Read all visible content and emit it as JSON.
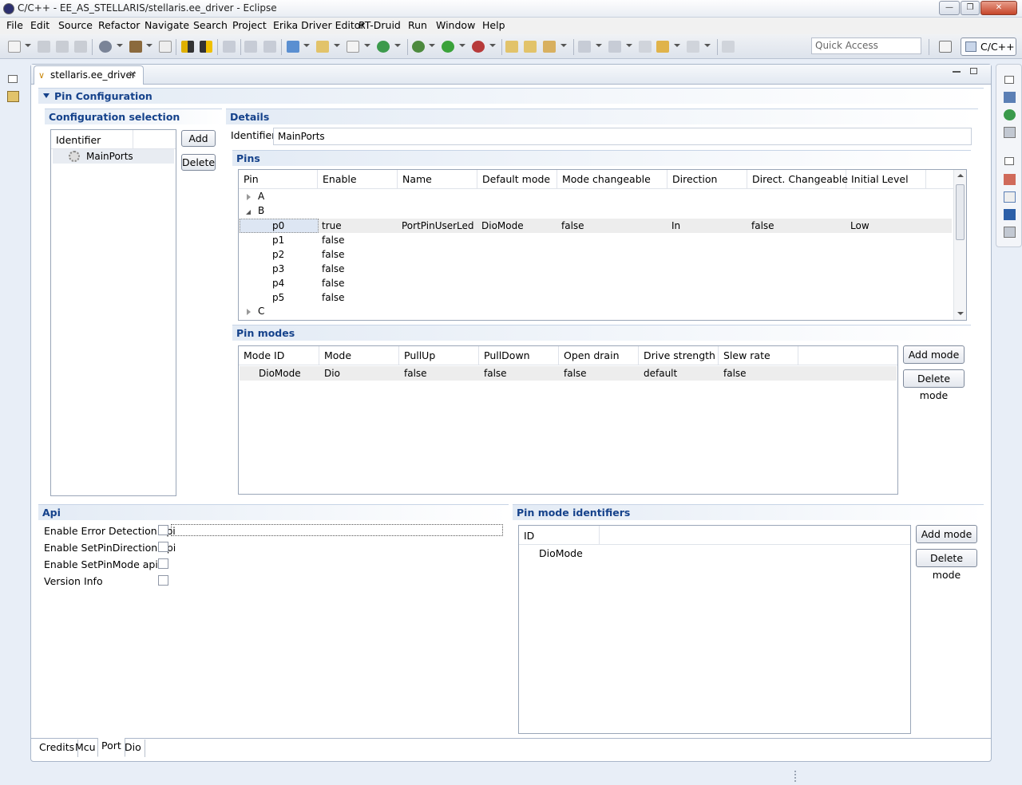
{
  "window": {
    "title": "C/C++ - EE_AS_STELLARIS/stellaris.ee_driver - Eclipse"
  },
  "menu": [
    "File",
    "Edit",
    "Source",
    "Refactor",
    "Navigate",
    "Search",
    "Project",
    "Erika Driver Editor",
    "RT-Druid",
    "Run",
    "Window",
    "Help"
  ],
  "toolbar": {
    "quick_access_placeholder": "Quick Access",
    "perspective": "C/C++"
  },
  "editor_tab": {
    "label": "stellaris.ee_driver"
  },
  "section_title": "Pin Configuration",
  "config_selection": {
    "title": "Configuration selection",
    "header": "Identifier",
    "items": [
      "MainPorts"
    ],
    "add_label": "Add",
    "delete_label": "Delete"
  },
  "details": {
    "title": "Details",
    "identifier_label": "Identifier",
    "identifier_value": "MainPorts"
  },
  "pins": {
    "title": "Pins",
    "columns": [
      "Pin",
      "Enable",
      "Name",
      "Default mode",
      "Mode changeable",
      "Direction",
      "Direct. Changeable",
      "Initial Level"
    ],
    "groups": [
      {
        "label": "A",
        "expanded": false
      },
      {
        "label": "B",
        "expanded": true
      },
      {
        "label": "C",
        "expanded": false
      }
    ],
    "rows": [
      {
        "pin": "p0",
        "enable": "true",
        "name": "PortPinUserLed",
        "default_mode": "DioMode",
        "mode_changeable": "false",
        "direction": "In",
        "direct_changeable": "false",
        "initial_level": "Low"
      },
      {
        "pin": "p1",
        "enable": "false"
      },
      {
        "pin": "p2",
        "enable": "false"
      },
      {
        "pin": "p3",
        "enable": "false"
      },
      {
        "pin": "p4",
        "enable": "false"
      },
      {
        "pin": "p5",
        "enable": "false"
      }
    ]
  },
  "pin_modes": {
    "title": "Pin modes",
    "columns": [
      "Mode ID",
      "Mode",
      "PullUp",
      "PullDown",
      "Open drain",
      "Drive strength",
      "Slew rate"
    ],
    "rows": [
      {
        "mode_id": "DioMode",
        "mode": "Dio",
        "pullup": "false",
        "pulldown": "false",
        "open_drain": "false",
        "drive_strength": "default",
        "slew_rate": "false"
      }
    ],
    "add_label": "Add mode",
    "delete_label": "Delete mode"
  },
  "api": {
    "title": "Api",
    "options": [
      {
        "label": "Enable Error Detection api",
        "checked": false
      },
      {
        "label": "Enable SetPinDirection api",
        "checked": false
      },
      {
        "label": "Enable SetPinMode api",
        "checked": false
      },
      {
        "label": "Version Info",
        "checked": false
      }
    ]
  },
  "pin_mode_identifiers": {
    "title": "Pin mode identifiers",
    "header": "ID",
    "items": [
      "DioMode"
    ],
    "add_label": "Add mode",
    "delete_label": "Delete mode"
  },
  "bottom_tabs": [
    "Credits",
    "Mcu",
    "Port",
    "Dio"
  ],
  "active_bottom_tab": "Port"
}
